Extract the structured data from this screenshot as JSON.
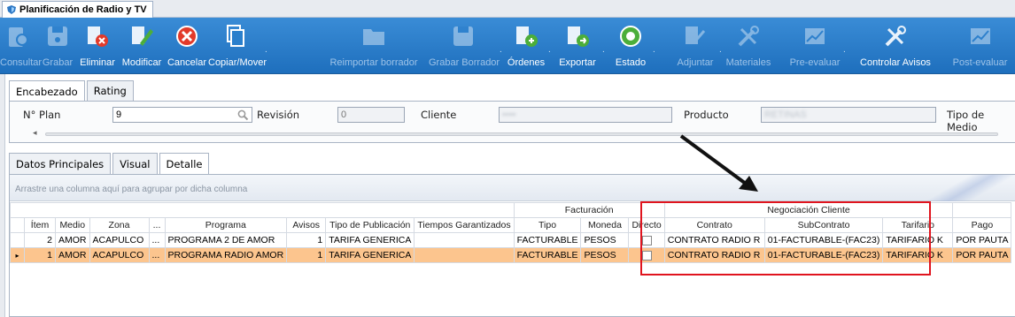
{
  "window": {
    "tab_title": "Planificación de Radio y TV"
  },
  "toolbar": {
    "buttons": [
      {
        "label": "Consultar",
        "icon": "consult-icon",
        "enabled": false
      },
      {
        "label": "Grabar",
        "icon": "save-icon",
        "enabled": false
      },
      {
        "label": "Eliminar",
        "icon": "delete-icon",
        "enabled": true
      },
      {
        "label": "Modificar",
        "icon": "edit-icon",
        "enabled": true
      },
      {
        "label": "Cancelar",
        "icon": "cancel-icon",
        "enabled": true
      },
      {
        "label": "Copiar/Mover",
        "icon": "copy-icon",
        "enabled": true
      },
      {
        "label": "Reimportar borrador",
        "icon": "folder-icon",
        "enabled": false
      },
      {
        "label": "Grabar Borrador",
        "icon": "save-draft-icon",
        "enabled": false
      },
      {
        "label": "Órdenes",
        "icon": "orders-icon",
        "enabled": true
      },
      {
        "label": "Exportar",
        "icon": "export-icon",
        "enabled": true
      },
      {
        "label": "Estado",
        "icon": "status-icon",
        "enabled": true
      },
      {
        "label": "Adjuntar",
        "icon": "attach-icon",
        "enabled": false
      },
      {
        "label": "Materiales",
        "icon": "tools-icon",
        "enabled": false
      },
      {
        "label": "Pre-evaluar",
        "icon": "chart-icon",
        "enabled": false
      },
      {
        "label": "Controlar Avisos",
        "icon": "tools-icon",
        "enabled": true
      },
      {
        "label": "Post-evaluar",
        "icon": "chart-icon",
        "enabled": false
      }
    ]
  },
  "header": {
    "tabs": [
      "Encabezado",
      "Rating"
    ],
    "plan_label": "N° Plan",
    "plan_value": "9",
    "revision_label": "Revisión",
    "revision_value": "0",
    "cliente_label": "Cliente",
    "cliente_value": "••••",
    "producto_label": "Producto",
    "producto_value": "RETINAS",
    "tipo_medio_label": "Tipo de Medio"
  },
  "detail": {
    "tabs": [
      "Datos Principales",
      "Visual",
      "Detalle"
    ],
    "group_hint": "Arrastre una columna aquí para agrupar por dicha columna",
    "band_facturacion": "Facturación",
    "band_negociacion": "Negociación Cliente",
    "columns": [
      "Ítem",
      "Medio",
      "Zona",
      "...",
      "Programa",
      "Avisos",
      "Tipo de Publicación",
      "Tiempos Garantizados",
      "Tipo",
      "Moneda",
      "Directo",
      "Contrato",
      "SubContrato",
      "Tarifario",
      "Pago"
    ],
    "rows": [
      {
        "item": "2",
        "medio": "AMOR",
        "zona": "ACAPULCO",
        "dots": "...",
        "programa": "PROGRAMA 2 DE AMOR",
        "avisos": "1",
        "tipo_pub": "TARIFA GENERICA",
        "tiempos": "",
        "tipo": "FACTURABLE",
        "moneda": "PESOS",
        "contrato": "CONTRATO RADIO R",
        "subcontrato": "01-FACTURABLE-(FAC23)",
        "tarifario": "TARIFARIO K",
        "pago": "POR PAUTA",
        "selected": false
      },
      {
        "item": "1",
        "medio": "AMOR",
        "zona": "ACAPULCO",
        "dots": "...",
        "programa": "PROGRAMA RADIO AMOR",
        "avisos": "1",
        "tipo_pub": "TARIFA GENERICA",
        "tiempos": "",
        "tipo": "FACTURABLE",
        "moneda": "PESOS",
        "contrato": "CONTRATO RADIO R",
        "subcontrato": "01-FACTURABLE-(FAC23)",
        "tarifario": "TARIFARIO K",
        "pago": "POR PAUTA",
        "selected": true
      }
    ]
  },
  "colors": {
    "toolbar": "#2a7fcc",
    "selected_row": "#fcc58e",
    "highlight_box": "#e0141e"
  }
}
